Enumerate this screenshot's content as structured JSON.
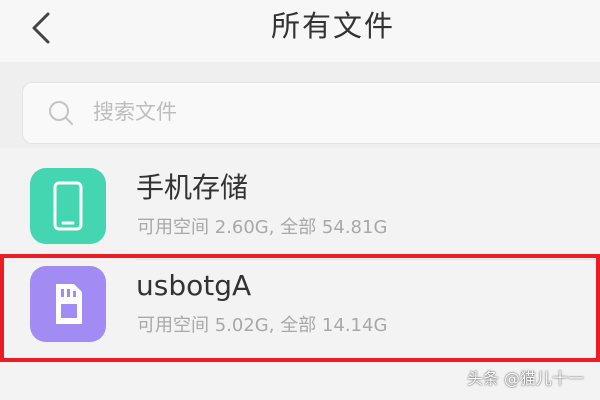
{
  "header": {
    "back_icon": "chevron-left-icon",
    "title": "所有文件"
  },
  "search": {
    "icon": "search-icon",
    "placeholder": "搜索文件"
  },
  "storage_items": [
    {
      "icon": "phone-icon",
      "icon_color": "#43d6b0",
      "name": "手机存储",
      "detail": "可用空间 2.60G, 全部 54.81G"
    },
    {
      "icon": "sd-card-icon",
      "icon_color": "#a28cf3",
      "name": "usbotgA",
      "detail": "可用空间 5.02G, 全部 14.14G",
      "highlighted": true
    }
  ],
  "highlight_color": "#ec1c24",
  "watermark": "头条 @猫儿十一"
}
